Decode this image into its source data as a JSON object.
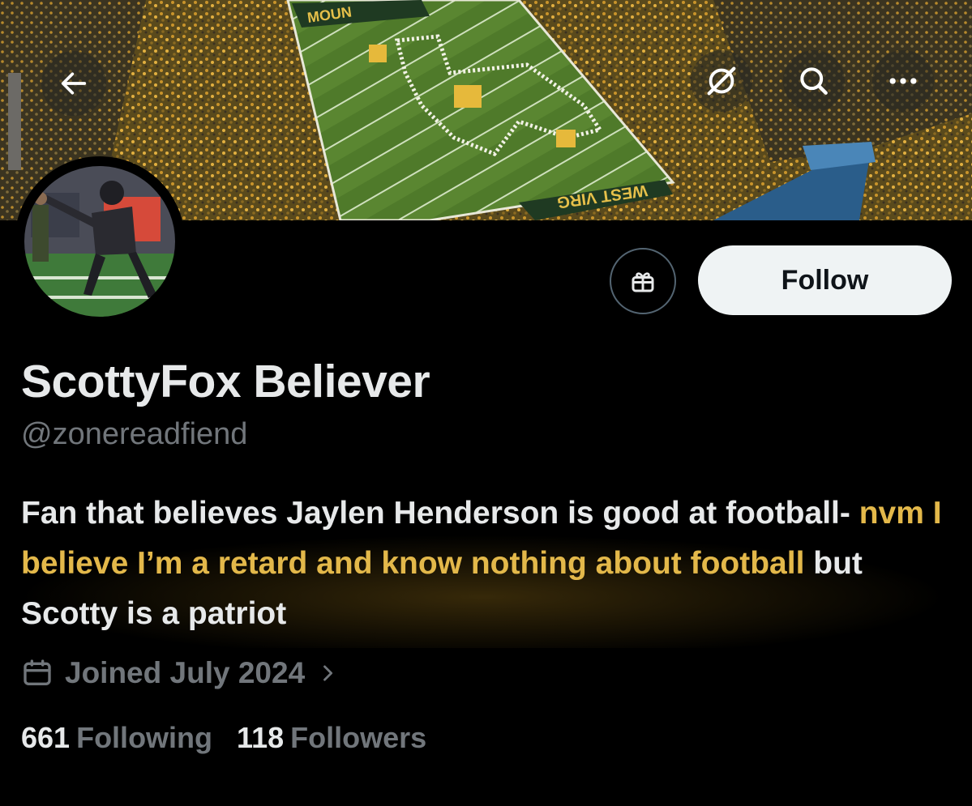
{
  "profile": {
    "display_name": "ScottyFox Believer",
    "handle": "@zonereadfiend",
    "bio_part1": "Fan that believes Jaylen Henderson is good at football-",
    "bio_highlight": "nvm I believe I’m a retard and know nothing about football",
    "bio_part3": "but Scotty is a patriot",
    "joined": "Joined July 2024",
    "following_count": "661",
    "following_label": "Following",
    "followers_count": "118",
    "followers_label": "Followers"
  },
  "actions": {
    "follow_label": "Follow"
  },
  "banner": {
    "field_text_top": "MOUN",
    "field_text_bottom": "WEST VIRG"
  },
  "icons": {
    "back": "arrow-left-icon",
    "grok": "grok-icon",
    "search": "search-icon",
    "more": "more-dots-icon",
    "gift": "gift-icon",
    "calendar": "calendar-icon",
    "chevron": "chevron-right-icon"
  },
  "colors": {
    "background": "#000000",
    "text": "#e7e9ea",
    "muted": "#71767b",
    "highlight": "#e3b84a",
    "follow_bg": "#eff3f4"
  }
}
